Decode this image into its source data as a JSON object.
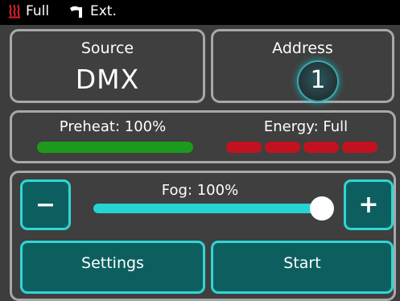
{
  "status": {
    "heater_icon": "heater-icon",
    "heater_color": "#e0202a",
    "fluid_text": "Full",
    "pump_icon": "pump-icon",
    "mode_text": "Ext."
  },
  "source": {
    "label": "Source",
    "value": "DMX"
  },
  "address": {
    "label": "Address",
    "value": "1"
  },
  "preheat": {
    "label": "Preheat: 100%",
    "level": 1.0,
    "color": "#1d9a1d"
  },
  "energy": {
    "label": "Energy: Full",
    "segments": 4,
    "segments_filled": 4,
    "color": "#c3121f"
  },
  "fog": {
    "label": "Fog: 100%",
    "value_percent": 100,
    "minus_label": "−",
    "plus_label": "+",
    "accent": "#2fd6d6"
  },
  "buttons": {
    "settings": "Settings",
    "start": "Start"
  },
  "colors": {
    "button_fill": "#0d5f5f",
    "tile_border": "#a8a8a8",
    "background": "#3d3d3d"
  }
}
